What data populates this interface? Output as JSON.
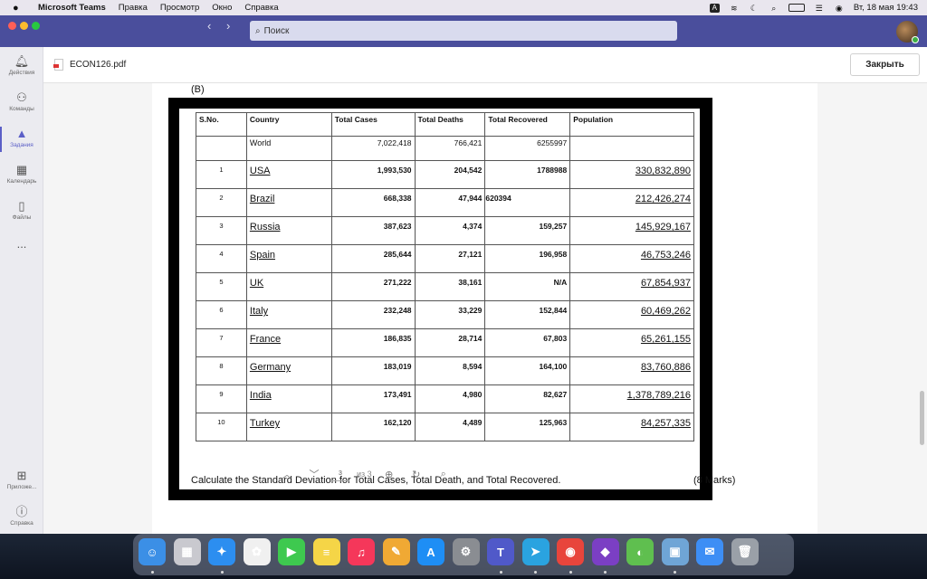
{
  "menubar": {
    "app": "Microsoft Teams",
    "items": [
      "Правка",
      "Просмотр",
      "Окно",
      "Справка"
    ],
    "datetime": "Вт, 18 мая 19:43",
    "input_indicator": "A"
  },
  "titlebar": {
    "search_placeholder": "Поиск"
  },
  "rail": {
    "items": [
      {
        "label": "Действия",
        "icon": "bell-icon"
      },
      {
        "label": "Команды",
        "icon": "teams-icon"
      },
      {
        "label": "Задания",
        "icon": "assignments-icon"
      },
      {
        "label": "Календарь",
        "icon": "calendar-icon"
      },
      {
        "label": "Файлы",
        "icon": "file-icon"
      },
      {
        "label": "...",
        "icon": "more-icon"
      }
    ],
    "bottom": [
      {
        "label": "Приложе...",
        "icon": "apps-icon"
      },
      {
        "label": "Справка",
        "icon": "help-icon"
      }
    ]
  },
  "file": {
    "name": "ECON126.pdf",
    "close_label": "Закрыть"
  },
  "document": {
    "section_label": "(B)",
    "columns": [
      "S.No.",
      "Country",
      "Total Cases",
      "Total Deaths",
      "Total Recovered",
      "Population"
    ],
    "world_row": {
      "sno": "",
      "country": "World",
      "cases": "7,022,418",
      "deaths": "766,421",
      "recovered": "6255997",
      "population": ""
    },
    "rows": [
      {
        "sno": "1",
        "country": "USA",
        "cases": "1,993,530",
        "deaths": "204,542",
        "recovered": "1788988",
        "population": "330,832,890"
      },
      {
        "sno": "2",
        "country": "Brazil",
        "cases": "668,338",
        "deaths": "47,944",
        "recovered": "620394",
        "population": "212,426,274"
      },
      {
        "sno": "3",
        "country": "Russia",
        "cases": "387,623",
        "deaths": "4,374",
        "recovered": "159,257",
        "population": "145,929,167"
      },
      {
        "sno": "4",
        "country": "Spain",
        "cases": "285,644",
        "deaths": "27,121",
        "recovered": "196,958",
        "population": "46,753,246"
      },
      {
        "sno": "5",
        "country": "UK",
        "cases": "271,222",
        "deaths": "38,161",
        "recovered": "N/A",
        "population": "67,854,937"
      },
      {
        "sno": "6",
        "country": "Italy",
        "cases": "232,248",
        "deaths": "33,229",
        "recovered": "152,844",
        "population": "60,469,262"
      },
      {
        "sno": "7",
        "country": "France",
        "cases": "186,835",
        "deaths": "28,714",
        "recovered": "67,803",
        "population": "65,261,155"
      },
      {
        "sno": "8",
        "country": "Germany",
        "cases": "183,019",
        "deaths": "8,594",
        "recovered": "164,100",
        "population": "83,760,886"
      },
      {
        "sno": "9",
        "country": "India",
        "cases": "173,491",
        "deaths": "4,980",
        "recovered": "82,627",
        "population": "1,378,789,216"
      },
      {
        "sno": "10",
        "country": "Turkey",
        "cases": "162,120",
        "deaths": "4,489",
        "recovered": "125,963",
        "population": "84,257,335"
      }
    ],
    "task": "Calculate the Standard Deviation for Total Cases, Total Death, and Total Recovered.",
    "marks": "(8 Marks)"
  },
  "pager": {
    "page": "3",
    "of_label": "из 3"
  },
  "dock": {
    "apps": [
      {
        "name": "finder-icon",
        "color": "#3b8fe6",
        "glyph": "☺"
      },
      {
        "name": "launchpad-icon",
        "color": "#c9c9cf",
        "glyph": "▦"
      },
      {
        "name": "safari-icon",
        "color": "#2c8ef0",
        "glyph": "✦"
      },
      {
        "name": "photos-icon",
        "color": "#f0f0f0",
        "glyph": "✿"
      },
      {
        "name": "facetime-icon",
        "color": "#3ec94f",
        "glyph": "▶"
      },
      {
        "name": "notes-icon",
        "color": "#f5d547",
        "glyph": "≡"
      },
      {
        "name": "music-icon",
        "color": "#f5375a",
        "glyph": "♫"
      },
      {
        "name": "pages-icon",
        "color": "#f0a934",
        "glyph": "✎"
      },
      {
        "name": "app-store-icon",
        "color": "#1e8ef5",
        "glyph": "A"
      },
      {
        "name": "system-preferences-icon",
        "color": "#8a8d92",
        "glyph": "⚙"
      },
      {
        "name": "teams-icon",
        "color": "#5059c9",
        "glyph": "T"
      },
      {
        "name": "telegram-icon",
        "color": "#2aa3e0",
        "glyph": "➤"
      },
      {
        "name": "chrome-icon",
        "color": "#e8453c",
        "glyph": "◉"
      },
      {
        "name": "visual-studio-icon",
        "color": "#7b3fc4",
        "glyph": "◆"
      },
      {
        "name": "color-picker-icon",
        "color": "#5fbf4f",
        "glyph": "◐"
      },
      {
        "name": "preview-icon",
        "color": "#6fa5d6",
        "glyph": "▣"
      },
      {
        "name": "mail-icon",
        "color": "#3d8ef5",
        "glyph": "✉"
      },
      {
        "name": "trash-icon",
        "color": "#9aa0a8",
        "glyph": "🗑"
      }
    ]
  }
}
